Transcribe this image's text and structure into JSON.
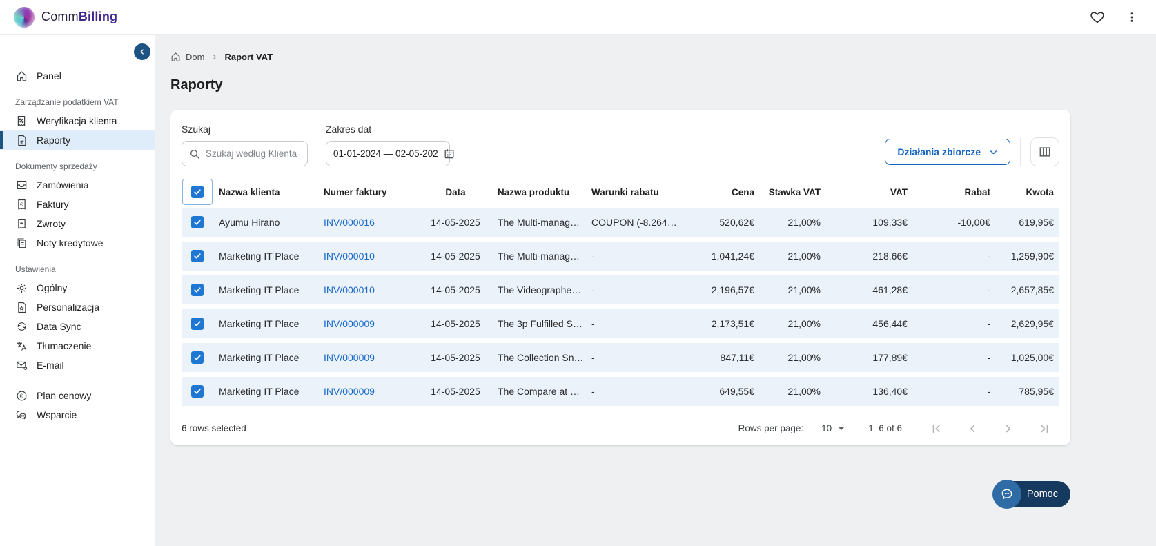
{
  "app": {
    "brand_first": "Comm",
    "brand_second": "Billing"
  },
  "colors": {
    "accent_blue": "#1565c0",
    "link_blue": "#1769cb",
    "checkbox_blue": "#1e78d3",
    "row_selected_bg": "#ecf2f9",
    "sidebar_active_bg": "#dfecf9",
    "sidebar_active_bar": "#1d5382",
    "help_pill_navy": "#16395f",
    "help_circle_blue": "#2f6ba5",
    "brand_purple": "#40268f"
  },
  "sidebar": {
    "groups": [
      {
        "label": "",
        "items": [
          {
            "label": "Panel"
          }
        ]
      },
      {
        "label": "Zarządzanie podatkiem VAT",
        "items": [
          {
            "label": "Weryfikacja klienta"
          },
          {
            "label": "Raporty"
          }
        ]
      },
      {
        "label": "Dokumenty sprzedaży",
        "items": [
          {
            "label": "Zamówienia"
          },
          {
            "label": "Faktury"
          },
          {
            "label": "Zwroty"
          },
          {
            "label": "Noty kredytowe"
          }
        ]
      },
      {
        "label": "Ustawienia",
        "items": [
          {
            "label": "Ogólny"
          },
          {
            "label": "Personalizacja"
          },
          {
            "label": "Data Sync"
          },
          {
            "label": "Tłumaczenie"
          },
          {
            "label": "E-mail"
          }
        ]
      },
      {
        "label": "",
        "items": [
          {
            "label": "Plan cenowy"
          },
          {
            "label": "Wsparcie"
          }
        ]
      }
    ]
  },
  "breadcrumb": {
    "home": "Dom",
    "current": "Raport VAT"
  },
  "page": {
    "title": "Raporty"
  },
  "filters": {
    "search_label": "Szukaj",
    "search_placeholder": "Szukaj według Klienta",
    "date_label": "Zakres dat",
    "date_value": "01-01-2024 — 02-05-202",
    "bulk_actions_label": "Działania zbiorcze"
  },
  "table": {
    "columns": [
      "Nazwa klienta",
      "Numer faktury",
      "Data",
      "Nazwa produktu",
      "Warunki rabatu",
      "Cena",
      "Stawka VAT",
      "VAT",
      "Rabat",
      "Kwota"
    ],
    "rows": [
      {
        "client": "Ayumu Hirano",
        "invoice": "INV/000016",
        "date": "14-05-2025",
        "product": "The Multi-manag…",
        "terms": "COUPON (-8.264…",
        "price": "520,62€",
        "rate": "21,00%",
        "vat": "109,33€",
        "discount": "-10,00€",
        "amount": "619,95€"
      },
      {
        "client": "Marketing IT Place",
        "invoice": "INV/000010",
        "date": "14-05-2025",
        "product": "The Multi-manag…",
        "terms": "-",
        "price": "1,041,24€",
        "rate": "21,00%",
        "vat": "218,66€",
        "discount": "-",
        "amount": "1,259,90€"
      },
      {
        "client": "Marketing IT Place",
        "invoice": "INV/000010",
        "date": "14-05-2025",
        "product": "The Videographe…",
        "terms": "-",
        "price": "2,196,57€",
        "rate": "21,00%",
        "vat": "461,28€",
        "discount": "-",
        "amount": "2,657,85€"
      },
      {
        "client": "Marketing IT Place",
        "invoice": "INV/000009",
        "date": "14-05-2025",
        "product": "The 3p Fulfilled S…",
        "terms": "-",
        "price": "2,173,51€",
        "rate": "21,00%",
        "vat": "456,44€",
        "discount": "-",
        "amount": "2,629,95€"
      },
      {
        "client": "Marketing IT Place",
        "invoice": "INV/000009",
        "date": "14-05-2025",
        "product": "The Collection Sn…",
        "terms": "-",
        "price": "847,11€",
        "rate": "21,00%",
        "vat": "177,89€",
        "discount": "-",
        "amount": "1,025,00€"
      },
      {
        "client": "Marketing IT Place",
        "invoice": "INV/000009",
        "date": "14-05-2025",
        "product": "The Compare at …",
        "terms": "-",
        "price": "649,55€",
        "rate": "21,00%",
        "vat": "136,40€",
        "discount": "-",
        "amount": "785,95€"
      }
    ]
  },
  "footer": {
    "selected_text": "6 rows selected",
    "rows_per_page_label": "Rows per page:",
    "rows_per_page_value": "10",
    "range_text": "1–6 of 6"
  },
  "help": {
    "label": "Pomoc"
  },
  "icons": {
    "euro": "€"
  }
}
